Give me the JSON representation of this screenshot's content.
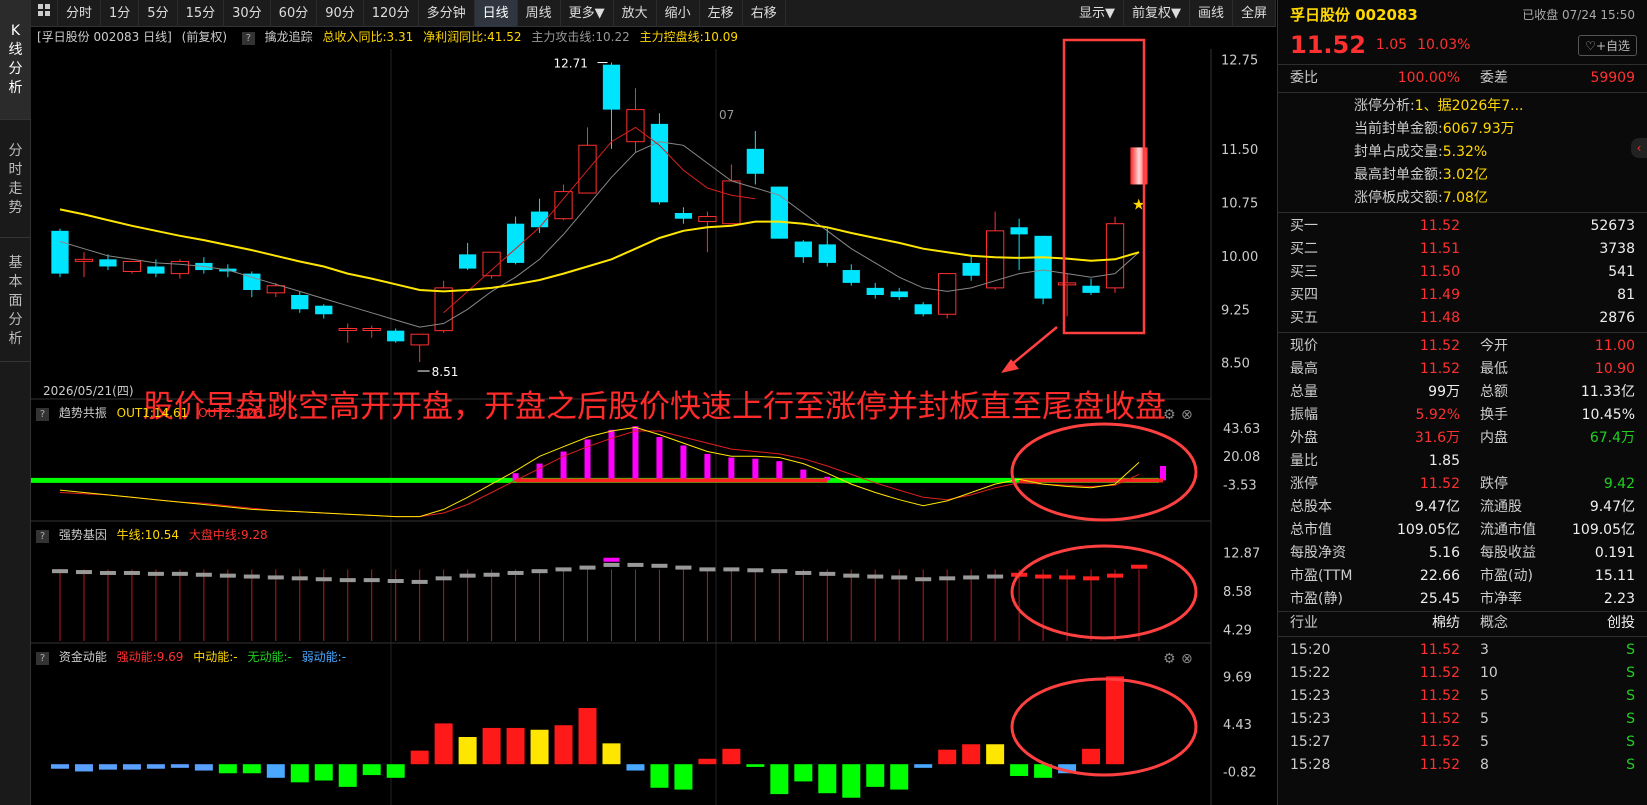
{
  "sidebar": {
    "items": [
      {
        "label": "K\n线\n分\n析"
      },
      {
        "label": "分\n时\n走\n势"
      },
      {
        "label": "基\n本\n面\n分\n析"
      }
    ]
  },
  "toolbar": {
    "grid_icon": "grid-icon",
    "left_buttons": [
      "分时",
      "1分",
      "5分",
      "15分",
      "30分",
      "60分",
      "90分",
      "120分",
      "多分钟",
      "日线",
      "周线",
      "更多▼",
      "放大",
      "缩小",
      "左移",
      "右移"
    ],
    "active": "日线",
    "right_buttons": [
      "显示▼",
      "前复权▼",
      "画线",
      "全屏"
    ]
  },
  "main_header": {
    "stock": "[孚日股份 002083 日线]",
    "adjust": "(前复权)",
    "indicator": "擒龙追踪",
    "rev": "总收入同比:3.31",
    "profit": "净利润同比:41.52",
    "attack": "主力攻击线:10.22",
    "control": "主力控盘线:10.09"
  },
  "main_axis": [
    "12.75",
    "11.50",
    "10.75",
    "10.00",
    "9.25",
    "8.50"
  ],
  "date_label": "2026/05/21(四)",
  "month_label": "07",
  "high_label": "12.71",
  "low_label": "8.51",
  "annotation": "股价早盘跳空高开开盘，开盘之后股价快速上行至涨停并封板直至尾盘收盘",
  "pane1": {
    "name": "趋势共振",
    "out1": "OUT1:14.61",
    "out2": "OUT2:5.26",
    "axis": [
      "43.63",
      "20.08",
      "-3.53"
    ]
  },
  "pane2": {
    "name": "强势基因",
    "niu": "牛线:10.54",
    "dapan": "大盘中线:9.28",
    "axis": [
      "12.87",
      "8.58",
      "4.29"
    ]
  },
  "pane3": {
    "name": "资金动能",
    "strong": "强动能:9.69",
    "mid": "中动能:-",
    "none": "无动能:-",
    "weak": "弱动能:-",
    "axis": [
      "9.69",
      "4.43",
      "-0.82"
    ]
  },
  "colors": {
    "up": "#ff3030",
    "down": "#00e5ff",
    "ma_yellow": "#ffe600",
    "ma_red": "#d42020",
    "ma_gray": "#888888"
  },
  "chart_data": {
    "type": "candlestick",
    "ylim": [
      8.3,
      12.9
    ],
    "candles": [
      [
        10.35,
        9.75,
        10.38,
        9.7
      ],
      [
        9.95,
        9.95,
        10.05,
        9.7
      ],
      [
        9.95,
        9.85,
        10.02,
        9.8
      ],
      [
        9.78,
        9.92,
        9.92,
        9.75
      ],
      [
        9.85,
        9.75,
        9.95,
        9.7
      ],
      [
        9.75,
        9.92,
        9.95,
        9.68
      ],
      [
        9.9,
        9.8,
        9.98,
        9.75
      ],
      [
        9.82,
        9.78,
        9.88,
        9.7
      ],
      [
        9.75,
        9.52,
        9.78,
        9.42
      ],
      [
        9.48,
        9.58,
        9.62,
        9.42
      ],
      [
        9.45,
        9.25,
        9.5,
        9.2
      ],
      [
        9.3,
        9.18,
        9.32,
        9.12
      ],
      [
        8.98,
        8.98,
        9.05,
        8.78
      ],
      [
        8.98,
        8.98,
        9.02,
        8.85
      ],
      [
        8.95,
        8.8,
        8.98,
        8.78
      ],
      [
        8.75,
        8.9,
        8.9,
        8.51
      ],
      [
        8.95,
        9.55,
        9.65,
        8.92
      ],
      [
        10.02,
        9.82,
        10.18,
        9.8
      ],
      [
        9.72,
        10.05,
        10.05,
        9.68
      ],
      [
        10.45,
        9.9,
        10.55,
        9.88
      ],
      [
        10.62,
        10.4,
        10.8,
        10.32
      ],
      [
        10.52,
        10.9,
        11.0,
        10.5
      ],
      [
        10.88,
        11.55,
        11.8,
        10.88
      ],
      [
        12.68,
        12.05,
        12.71,
        11.5
      ],
      [
        11.6,
        12.05,
        12.35,
        11.45
      ],
      [
        11.85,
        10.75,
        12.0,
        10.72
      ],
      [
        10.6,
        10.52,
        10.68,
        10.45
      ],
      [
        10.48,
        10.55,
        10.62,
        10.05
      ],
      [
        10.45,
        11.05,
        11.28,
        10.45
      ],
      [
        11.5,
        11.15,
        11.75,
        11.0
      ],
      [
        10.97,
        10.24,
        10.97,
        10.24
      ],
      [
        10.2,
        9.98,
        10.22,
        9.9
      ],
      [
        10.16,
        9.9,
        10.4,
        9.85
      ],
      [
        9.8,
        9.62,
        9.88,
        9.58
      ],
      [
        9.55,
        9.45,
        9.62,
        9.4
      ],
      [
        9.5,
        9.42,
        9.55,
        9.38
      ],
      [
        9.32,
        9.18,
        9.35,
        9.15
      ],
      [
        9.18,
        9.75,
        9.75,
        9.12
      ],
      [
        9.9,
        9.72,
        10.0,
        9.65
      ],
      [
        9.55,
        10.35,
        10.62,
        9.52
      ],
      [
        10.4,
        10.3,
        10.52,
        9.8
      ],
      [
        10.28,
        9.4,
        10.28,
        9.32
      ],
      [
        9.6,
        9.62,
        9.75,
        9.15
      ],
      [
        9.58,
        9.48,
        9.68,
        9.45
      ],
      [
        9.55,
        10.45,
        10.55,
        9.48
      ]
    ],
    "last_candle": {
      "open": 11.0,
      "close": 11.52,
      "high": 11.52,
      "low": 10.9
    },
    "ma_yellow": [
      10.65,
      10.58,
      10.5,
      10.42,
      10.35,
      10.28,
      10.22,
      10.15,
      10.08,
      10.0,
      9.92,
      9.85,
      9.75,
      9.68,
      9.6,
      9.52,
      9.5,
      9.52,
      9.55,
      9.6,
      9.66,
      9.75,
      9.85,
      9.95,
      10.1,
      10.25,
      10.35,
      10.4,
      10.42,
      10.48,
      10.48,
      10.45,
      10.4,
      10.32,
      10.25,
      10.18,
      10.1,
      10.05,
      10.0,
      9.98,
      9.97,
      9.98,
      9.96,
      9.93,
      9.95,
      10.05
    ],
    "ma_gray": [
      10.2,
      10.1,
      10.0,
      9.95,
      9.9,
      9.88,
      9.85,
      9.8,
      9.7,
      9.6,
      9.5,
      9.4,
      9.3,
      9.2,
      9.1,
      9.0,
      9.05,
      9.25,
      9.5,
      9.7,
      9.95,
      10.3,
      10.7,
      11.1,
      11.45,
      11.6,
      11.55,
      11.3,
      11.05,
      10.95,
      10.85,
      10.6,
      10.35,
      10.1,
      9.9,
      9.7,
      9.55,
      9.5,
      9.55,
      9.65,
      9.75,
      9.8,
      9.75,
      9.7,
      9.75,
      10.05
    ],
    "ma_red": [
      null,
      null,
      null,
      null,
      null,
      null,
      null,
      null,
      null,
      null,
      null,
      null,
      null,
      null,
      null,
      null,
      9.2,
      9.5,
      9.8,
      10.1,
      10.4,
      10.8,
      11.2,
      11.6,
      11.8,
      11.55,
      11.2,
      10.95,
      10.85,
      10.8
    ],
    "pane1_hist": [
      0,
      0,
      0,
      0,
      0,
      0,
      0,
      0,
      0,
      0,
      0,
      0,
      0,
      0,
      0,
      0,
      0,
      0,
      0,
      6,
      14,
      24,
      34,
      42,
      45,
      36,
      29,
      22,
      19,
      18,
      16,
      9,
      3,
      0,
      0,
      0,
      0,
      0,
      0,
      0,
      0,
      0,
      0,
      0,
      0,
      0,
      12
    ],
    "pane1_yellow": [
      -8,
      -10,
      -12,
      -14,
      -16,
      -18,
      -20,
      -22,
      -24,
      -25,
      -26,
      -27,
      -28,
      -29,
      -30,
      -30,
      -24,
      -14,
      -3,
      8,
      20,
      28,
      36,
      41,
      44,
      38,
      31,
      24,
      20,
      20,
      19,
      14,
      6,
      -3,
      -10,
      -16,
      -21,
      -17,
      -10,
      -3,
      1,
      -3,
      -5,
      -6,
      -3,
      15
    ],
    "pane1_red": [
      -10,
      -11,
      -12,
      -14,
      -16,
      -18,
      -19,
      -21,
      -23,
      -25,
      -26,
      -27,
      -28,
      -29,
      -30,
      -30,
      -27,
      -20,
      -10,
      0,
      10,
      20,
      28,
      35,
      41,
      41,
      36,
      31,
      26,
      24,
      22,
      18,
      12,
      5,
      -2,
      -8,
      -14,
      -16,
      -12,
      -6,
      -2,
      -3,
      -4,
      -5,
      -4,
      5
    ],
    "pane2_bars": [
      10.8,
      10.7,
      10.6,
      10.6,
      10.5,
      10.5,
      10.4,
      10.3,
      10.2,
      10.1,
      10.0,
      9.9,
      9.8,
      9.8,
      9.7,
      9.6,
      10.0,
      10.3,
      10.4,
      10.6,
      10.8,
      11.0,
      11.2,
      11.5,
      11.5,
      11.4,
      11.2,
      11.0,
      11.0,
      10.9,
      10.8,
      10.6,
      10.5,
      10.3,
      10.2,
      10.1,
      9.9,
      10.0,
      10.1,
      10.2,
      10.4,
      10.2,
      10.1,
      10.0,
      10.3,
      11.3
    ],
    "pane3_bars": [
      -0.5,
      -0.8,
      -0.6,
      -0.6,
      -0.5,
      -0.4,
      -0.7,
      -1.0,
      -1.0,
      -1.5,
      -2.0,
      -1.8,
      -2.5,
      -1.2,
      -1.5,
      1.5,
      4.5,
      3.0,
      4.0,
      4.0,
      3.8,
      4.3,
      6.2,
      2.3,
      -0.7,
      -2.6,
      -2.8,
      0.6,
      1.7,
      -0.3,
      -3.3,
      -1.9,
      -3.2,
      -3.7,
      -2.5,
      -2.8,
      -0.4,
      1.6,
      2.2,
      2.2,
      -1.3,
      -1.5,
      -1.0,
      1.7,
      9.69
    ]
  },
  "quote": {
    "name": "孚日股份 002083",
    "status": "已收盘 07/24 15:50",
    "price": "11.52",
    "change": "1.05",
    "pct": "10.03%",
    "fav": "+自选",
    "weibi_label": "委比",
    "weibi": "100.00%",
    "weicha_label": "委差",
    "weicha": "59909",
    "limit_info": [
      [
        "涨停分析:",
        "1、据2026年7..."
      ],
      [
        "当前封单金额:",
        "6067.93万"
      ],
      [
        "封单占成交量:",
        "5.32%"
      ],
      [
        "最高封单金额:",
        "3.02亿"
      ],
      [
        "涨停板成交额:",
        "7.08亿"
      ]
    ],
    "bids": [
      [
        "买一",
        "11.52",
        "52673"
      ],
      [
        "买二",
        "11.51",
        "3738"
      ],
      [
        "买三",
        "11.50",
        "541"
      ],
      [
        "买四",
        "11.49",
        "81"
      ],
      [
        "买五",
        "11.48",
        "2876"
      ]
    ],
    "stats": [
      [
        "现价",
        "11.52",
        "今开",
        "11.00"
      ],
      [
        "最高",
        "11.52",
        "最低",
        "10.90"
      ],
      [
        "总量",
        "99万",
        "总额",
        "11.33亿"
      ],
      [
        "振幅",
        "5.92%",
        "换手",
        "10.45%"
      ],
      [
        "外盘",
        "31.6万",
        "内盘",
        "67.4万"
      ],
      [
        "量比",
        "1.85",
        "",
        ""
      ],
      [
        "涨停",
        "11.52",
        "跌停",
        "9.42"
      ],
      [
        "总股本",
        "9.47亿",
        "流通股",
        "9.47亿"
      ],
      [
        "总市值",
        "109.05亿",
        "流通市值",
        "109.05亿"
      ],
      [
        "每股净资",
        "5.16",
        "每股收益",
        "0.191"
      ],
      [
        "市盈(TTM",
        "22.66",
        "市盈(动)",
        "15.11"
      ],
      [
        "市盈(静)",
        "25.45",
        "市净率",
        "2.23"
      ]
    ],
    "category": [
      "行业",
      "棉纺",
      "概念",
      "创投"
    ],
    "ticks": [
      [
        "15:20",
        "11.52",
        "3",
        "S"
      ],
      [
        "15:22",
        "11.52",
        "10",
        "S"
      ],
      [
        "15:23",
        "11.52",
        "5",
        "S"
      ],
      [
        "15:23",
        "11.52",
        "5",
        "S"
      ],
      [
        "15:27",
        "11.52",
        "5",
        "S"
      ],
      [
        "15:28",
        "11.52",
        "8",
        "S"
      ]
    ]
  }
}
